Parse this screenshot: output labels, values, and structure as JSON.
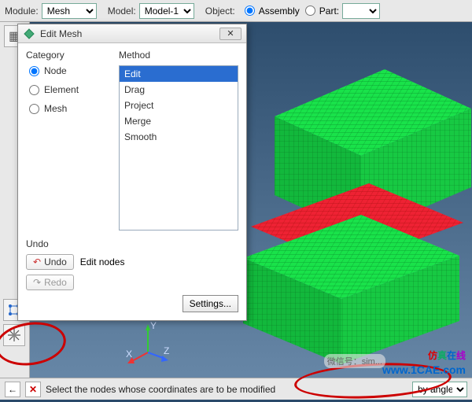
{
  "topbar": {
    "module_label": "Module:",
    "module_value": "Mesh",
    "model_label": "Model:",
    "model_value": "Model-1",
    "object_label": "Object:",
    "assembly_label": "Assembly",
    "part_label": "Part:",
    "part_value": ""
  },
  "dialog": {
    "title": "Edit Mesh",
    "category_label": "Category",
    "method_label": "Method",
    "categories": [
      {
        "label": "Node",
        "checked": true
      },
      {
        "label": "Element",
        "checked": false
      },
      {
        "label": "Mesh",
        "checked": false
      }
    ],
    "methods": [
      "Edit",
      "Drag",
      "Project",
      "Merge",
      "Smooth"
    ],
    "selected_method_index": 0,
    "undo_label": "Undo",
    "undo_btn": "Undo",
    "redo_btn": "Redo",
    "undo_desc": "Edit nodes",
    "settings_btn": "Settings..."
  },
  "status": {
    "prompt": "Select the nodes whose coordinates are to be modified",
    "filter_value": "by angle"
  },
  "triad": {
    "x": "X",
    "y": "Y",
    "z": "Z"
  },
  "watermark": {
    "center": "1CAE.C",
    "cn": "仿真在线",
    "url": "www.1CAE.com",
    "wx": "微信号：sim..."
  },
  "colors": {
    "mesh_primary": "#19e24a",
    "mesh_edge": "#0a8a2a",
    "mesh_highlight": "#d11",
    "dialog_select": "#2a6dd0"
  }
}
